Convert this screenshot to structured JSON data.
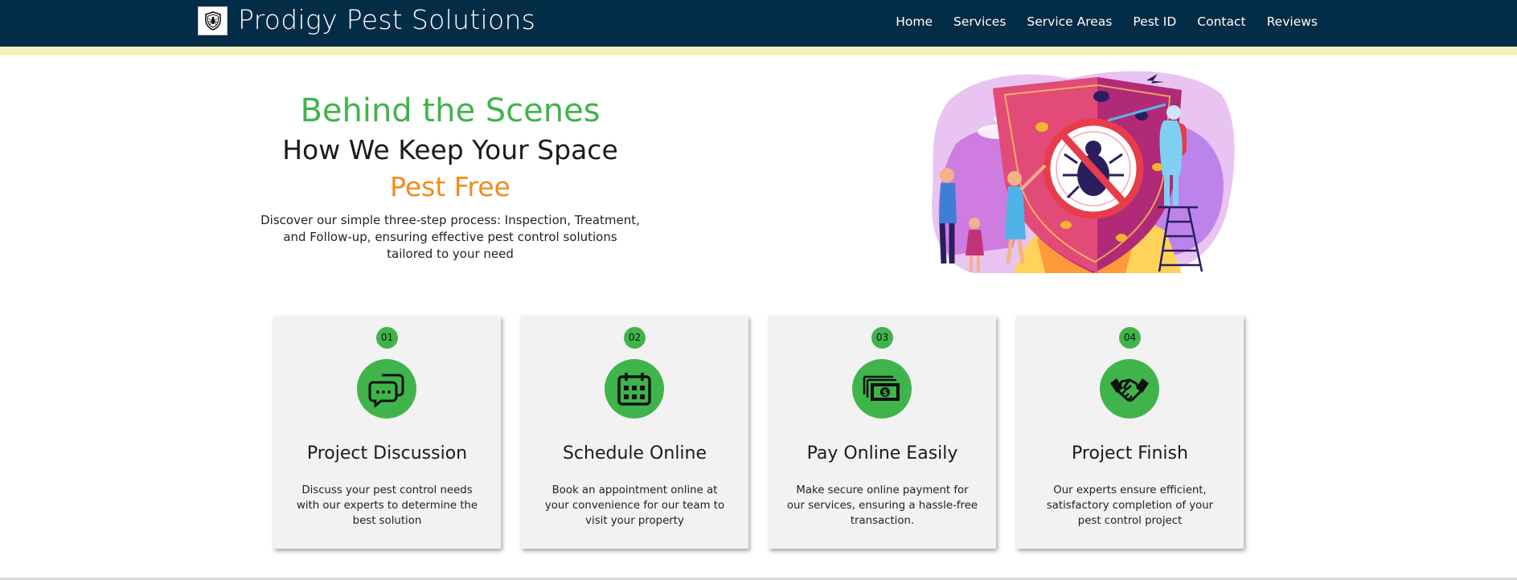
{
  "header": {
    "brand": "Prodigy Pest Solutions",
    "logo_icon": "shield-bug-icon",
    "nav": [
      "Home",
      "Services",
      "Service Areas",
      "Pest ID",
      "Contact",
      "Reviews"
    ]
  },
  "hero": {
    "title_green": "Behind the Scenes",
    "title_dark": "How We Keep Your Space",
    "title_orange": "Pest Free",
    "description": "Discover our simple three-step process: Inspection, Treatment, and Follow-up, ensuring effective pest control solutions tailored to your need"
  },
  "steps": [
    {
      "number": "01",
      "icon": "chat-bubbles-icon",
      "title": "Project Discussion",
      "description": "Discuss your pest control needs with our experts to determine the best solution"
    },
    {
      "number": "02",
      "icon": "calendar-icon",
      "title": "Schedule Online",
      "description": "Book an appointment online at your convenience for our team to visit your property"
    },
    {
      "number": "03",
      "icon": "money-icon",
      "title": "Pay Online Easily",
      "description": "Make secure online payment for our services, ensuring a hassle-free transaction."
    },
    {
      "number": "04",
      "icon": "handshake-icon",
      "title": "Project Finish",
      "description": "Our experts ensure efficient, satisfactory completion of your pest control project"
    }
  ],
  "colors": {
    "nav_bg": "#032c46",
    "nav_stripe": "#f6efbb",
    "accent_green": "#3fb44a",
    "accent_orange": "#f28a1c",
    "card_bg": "#f2f2f2"
  }
}
